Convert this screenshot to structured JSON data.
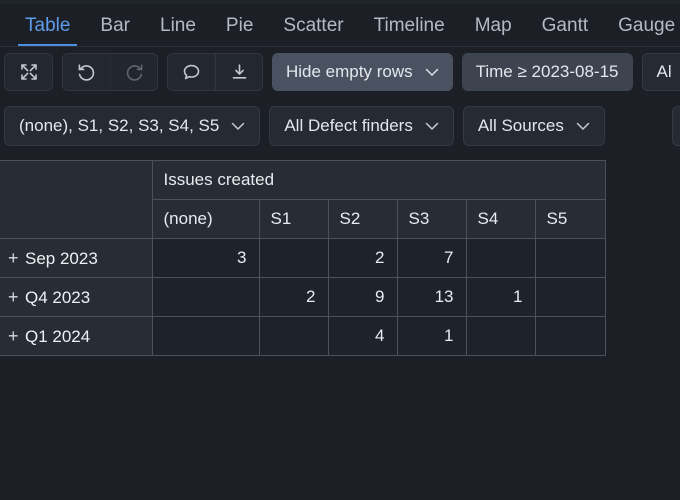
{
  "tabs": [
    {
      "label": "Table",
      "active": true
    },
    {
      "label": "Bar",
      "active": false
    },
    {
      "label": "Line",
      "active": false
    },
    {
      "label": "Pie",
      "active": false
    },
    {
      "label": "Scatter",
      "active": false
    },
    {
      "label": "Timeline",
      "active": false
    },
    {
      "label": "Map",
      "active": false
    },
    {
      "label": "Gantt",
      "active": false
    },
    {
      "label": "Gauge",
      "active": false
    }
  ],
  "toolbar": {
    "icons": [
      {
        "name": "fullscreen-icon",
        "label": "Fullscreen",
        "disabled": false
      },
      {
        "name": "undo-icon",
        "label": "Undo",
        "disabled": false
      },
      {
        "name": "redo-icon",
        "label": "Redo",
        "disabled": true
      },
      {
        "name": "comment-icon",
        "label": "Comment",
        "disabled": false
      },
      {
        "name": "download-icon",
        "label": "Download",
        "disabled": false
      }
    ],
    "hide_empty_rows": "Hide empty rows",
    "time_filter": "Time ≥ 2023-08-15",
    "cut_off_button": "Al",
    "chevron": "⌄"
  },
  "filters": {
    "series": "(none), S1, S2, S3, S4, S5",
    "defect_finders": "All Defect finders",
    "sources": "All Sources"
  },
  "chart_data": {
    "type": "table",
    "title": "Issues created",
    "row_header_label": "",
    "categories": [
      "(none)",
      "S1",
      "S2",
      "S3",
      "S4",
      "S5"
    ],
    "rows": [
      {
        "label": "Sep 2023",
        "expander": "+",
        "values": [
          "3",
          "",
          "2",
          "7",
          "",
          ""
        ]
      },
      {
        "label": "Q4 2023",
        "expander": "+",
        "values": [
          "",
          "2",
          "9",
          "13",
          "1",
          ""
        ]
      },
      {
        "label": "Q1 2024",
        "expander": "+",
        "values": [
          "",
          "",
          "4",
          "1",
          "",
          ""
        ]
      }
    ],
    "xlabel": "",
    "ylabel": ""
  },
  "colors": {
    "background": "#1c2026",
    "accent": "#5e9cea",
    "header_cell": "#272c35",
    "data_cell": "#1e222a",
    "grid_line": "#4a505c"
  }
}
